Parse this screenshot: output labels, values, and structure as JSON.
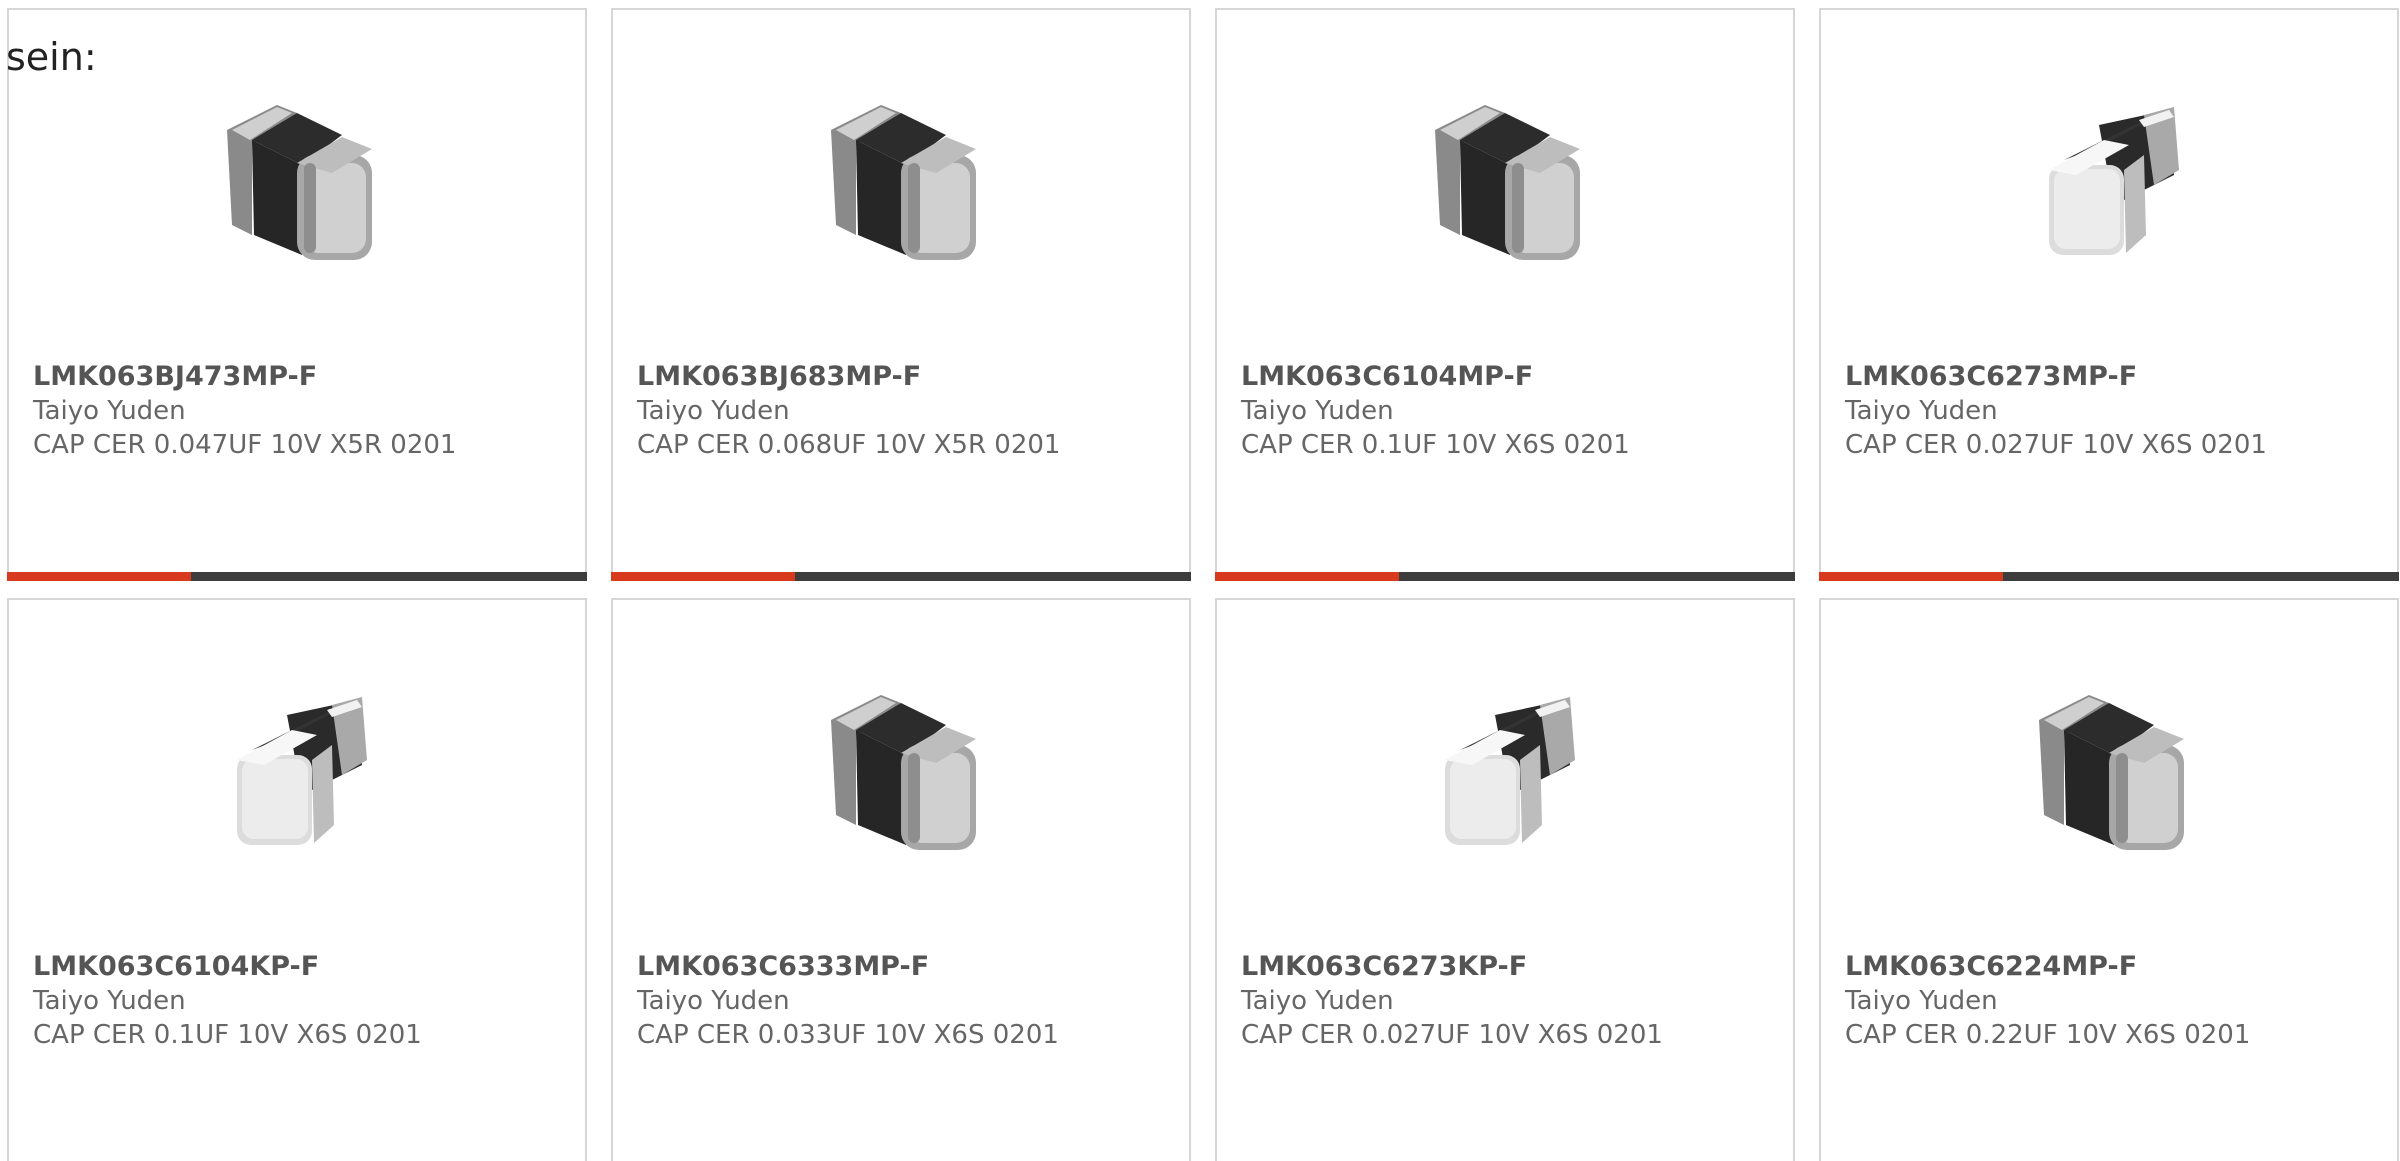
{
  "intro_text": "sein:",
  "colors": {
    "accent": "#d83a1d",
    "bar": "#3d3d3d",
    "card_border": "#d6d6d6",
    "text": "#666666"
  },
  "products": [
    {
      "part": "LMK063BJ473MP-F",
      "maker": "Taiyo Yuden",
      "desc": "CAP CER 0.047UF 10V X5R 0201",
      "image": "capacitor-chip-grey-front"
    },
    {
      "part": "LMK063BJ683MP-F",
      "maker": "Taiyo Yuden",
      "desc": "CAP CER 0.068UF 10V X5R 0201",
      "image": "capacitor-chip-grey-front"
    },
    {
      "part": "LMK063C6104MP-F",
      "maker": "Taiyo Yuden",
      "desc": "CAP CER 0.1UF 10V X6S 0201",
      "image": "capacitor-chip-grey-front"
    },
    {
      "part": "LMK063C6273MP-F",
      "maker": "Taiyo Yuden",
      "desc": "CAP CER 0.027UF 10V X6S 0201",
      "image": "capacitor-chip-white-left"
    },
    {
      "part": "LMK063C6104KP-F",
      "maker": "Taiyo Yuden",
      "desc": "CAP CER 0.1UF 10V X6S 0201",
      "image": "capacitor-chip-white-left"
    },
    {
      "part": "LMK063C6333MP-F",
      "maker": "Taiyo Yuden",
      "desc": "CAP CER 0.033UF 10V X6S 0201",
      "image": "capacitor-chip-grey-front"
    },
    {
      "part": "LMK063C6273KP-F",
      "maker": "Taiyo Yuden",
      "desc": "CAP CER 0.027UF 10V X6S 0201",
      "image": "capacitor-chip-white-left"
    },
    {
      "part": "LMK063C6224MP-F",
      "maker": "Taiyo Yuden",
      "desc": "CAP CER 0.22UF 10V X6S 0201",
      "image": "capacitor-chip-grey-front"
    }
  ]
}
